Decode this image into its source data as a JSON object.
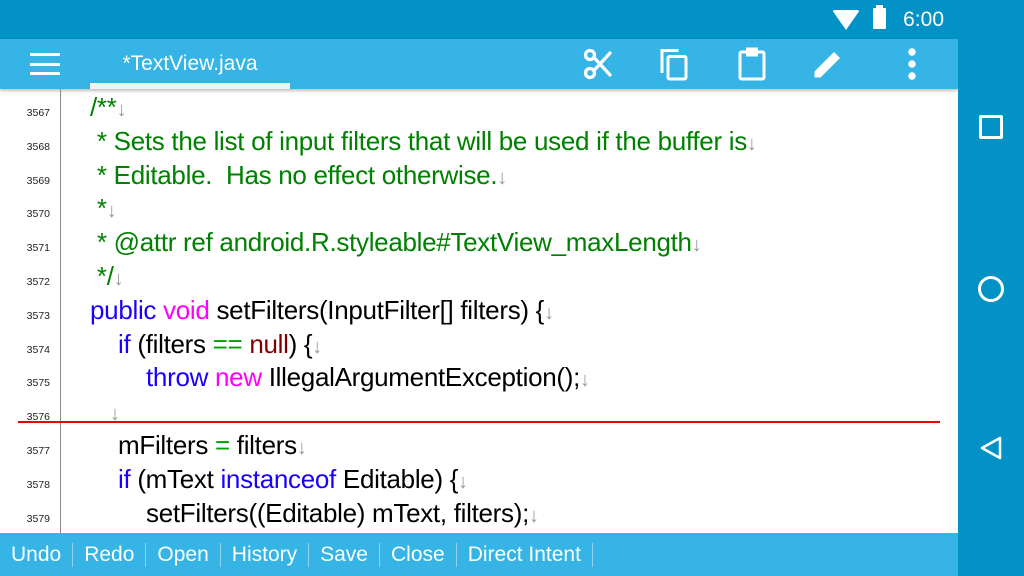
{
  "status_bar": {
    "time": "6:00",
    "icons": [
      "wifi-icon",
      "battery-icon"
    ]
  },
  "toolbar": {
    "tab_title": "*TextView.java",
    "actions": [
      "cut-icon",
      "copy-icon",
      "paste-icon",
      "edit-icon",
      "more-icon"
    ]
  },
  "editor": {
    "lines": [
      {
        "n": "3567",
        "indent": 90,
        "segs": [
          {
            "t": "/**",
            "c": "cm"
          },
          {
            "t": "↓",
            "c": "ar"
          }
        ]
      },
      {
        "n": "3568",
        "indent": 90,
        "segs": [
          {
            "t": " * Sets the list of input filters that will be used if the buffer is",
            "c": "cm"
          },
          {
            "t": "↓",
            "c": "ar"
          }
        ]
      },
      {
        "n": "3569",
        "indent": 90,
        "segs": [
          {
            "t": " * Editable.  Has no effect otherwise.",
            "c": "cm"
          },
          {
            "t": "↓",
            "c": "ar"
          }
        ]
      },
      {
        "n": "3570",
        "indent": 90,
        "segs": [
          {
            "t": " *",
            "c": "cm"
          },
          {
            "t": "↓",
            "c": "ar"
          }
        ]
      },
      {
        "n": "3571",
        "indent": 90,
        "segs": [
          {
            "t": " * @attr ref android.R.styleable#TextView_maxLength",
            "c": "cm"
          },
          {
            "t": "↓",
            "c": "ar"
          }
        ]
      },
      {
        "n": "3572",
        "indent": 90,
        "segs": [
          {
            "t": " */",
            "c": "cm"
          },
          {
            "t": "↓",
            "c": "ar"
          }
        ]
      },
      {
        "n": "3573",
        "indent": 90,
        "segs": [
          {
            "t": "public ",
            "c": "kw"
          },
          {
            "t": "void ",
            "c": "mg"
          },
          {
            "t": "setFilters(InputFilter[] filters) {",
            "c": ""
          },
          {
            "t": "↓",
            "c": "ar"
          }
        ]
      },
      {
        "n": "3574",
        "indent": 118,
        "segs": [
          {
            "t": "if ",
            "c": "kw"
          },
          {
            "t": "(filters ",
            "c": ""
          },
          {
            "t": "== ",
            "c": "op"
          },
          {
            "t": "null",
            "c": "nl"
          },
          {
            "t": ") {",
            "c": ""
          },
          {
            "t": "↓",
            "c": "ar"
          }
        ]
      },
      {
        "n": "3575",
        "indent": 146,
        "segs": [
          {
            "t": "throw ",
            "c": "kw"
          },
          {
            "t": "new ",
            "c": "mg"
          },
          {
            "t": "IllegalArgumentException();",
            "c": ""
          },
          {
            "t": "↓",
            "c": "ar"
          }
        ]
      },
      {
        "n": "3576",
        "indent": 110,
        "segs": [
          {
            "t": "↓",
            "c": "ar"
          }
        ]
      },
      {
        "n": "3577",
        "indent": 118,
        "segs": [
          {
            "t": "mFilters ",
            "c": ""
          },
          {
            "t": "= ",
            "c": "op"
          },
          {
            "t": "filters",
            "c": ""
          },
          {
            "t": "↓",
            "c": "ar"
          }
        ]
      },
      {
        "n": "3578",
        "indent": 118,
        "segs": [
          {
            "t": "if ",
            "c": "kw"
          },
          {
            "t": "(mText ",
            "c": ""
          },
          {
            "t": "instanceof ",
            "c": "kw"
          },
          {
            "t": "Editable) {",
            "c": ""
          },
          {
            "t": "↓",
            "c": "ar"
          }
        ]
      },
      {
        "n": "3579",
        "indent": 146,
        "segs": [
          {
            "t": "setFilters((Editable) mText, filters);",
            "c": ""
          },
          {
            "t": "↓",
            "c": "ar"
          }
        ]
      }
    ]
  },
  "bottom_bar": {
    "buttons": [
      "Undo",
      "Redo",
      "Open",
      "History",
      "Save",
      "Close",
      "Direct Intent"
    ]
  }
}
